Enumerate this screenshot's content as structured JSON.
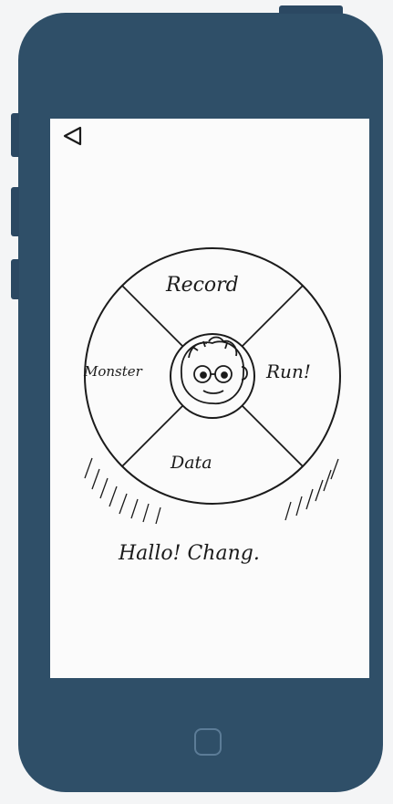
{
  "screen": {
    "back_icon": "back-triangle-icon",
    "avatar_icon": "monster-face-icon"
  },
  "menu": {
    "top": "Record",
    "left": "Monster",
    "right": "Run!",
    "bottom": "Data"
  },
  "greeting": "Hallo! Chang.",
  "colors": {
    "phone_body": "#2f4f68",
    "screen": "#fbfbfb",
    "ink": "#1b1b1b"
  }
}
